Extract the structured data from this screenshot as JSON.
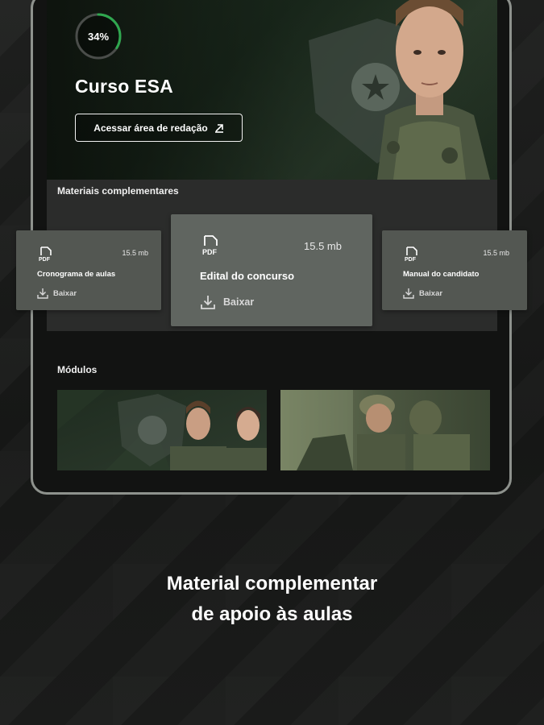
{
  "hero": {
    "progress_label": "34%",
    "progress_value": 0.34,
    "course_title": "Curso ESA",
    "redacao_button": "Acessar área de redação"
  },
  "materials": {
    "section_title": "Materiais complementares",
    "items": [
      {
        "icon": "pdf-icon",
        "icon_label": "PDF",
        "size": "15.5 mb",
        "title": "Cronograma de aulas",
        "download": "Baixar"
      },
      {
        "icon": "pdf-icon",
        "icon_label": "PDF",
        "size": "15.5 mb",
        "title": "Edital do concurso",
        "download": "Baixar"
      },
      {
        "icon": "pdf-icon",
        "icon_label": "PDF",
        "size": "15.5 mb",
        "title": "Manual do candidato",
        "download": "Baixar"
      }
    ]
  },
  "modules": {
    "section_title": "Módulos"
  },
  "caption": {
    "line1": "Material complementar",
    "line2": "de apoio às aulas"
  },
  "colors": {
    "progress_accent": "#2fa84f",
    "card_bg": "#535752",
    "card_bg_active": "#606560"
  }
}
